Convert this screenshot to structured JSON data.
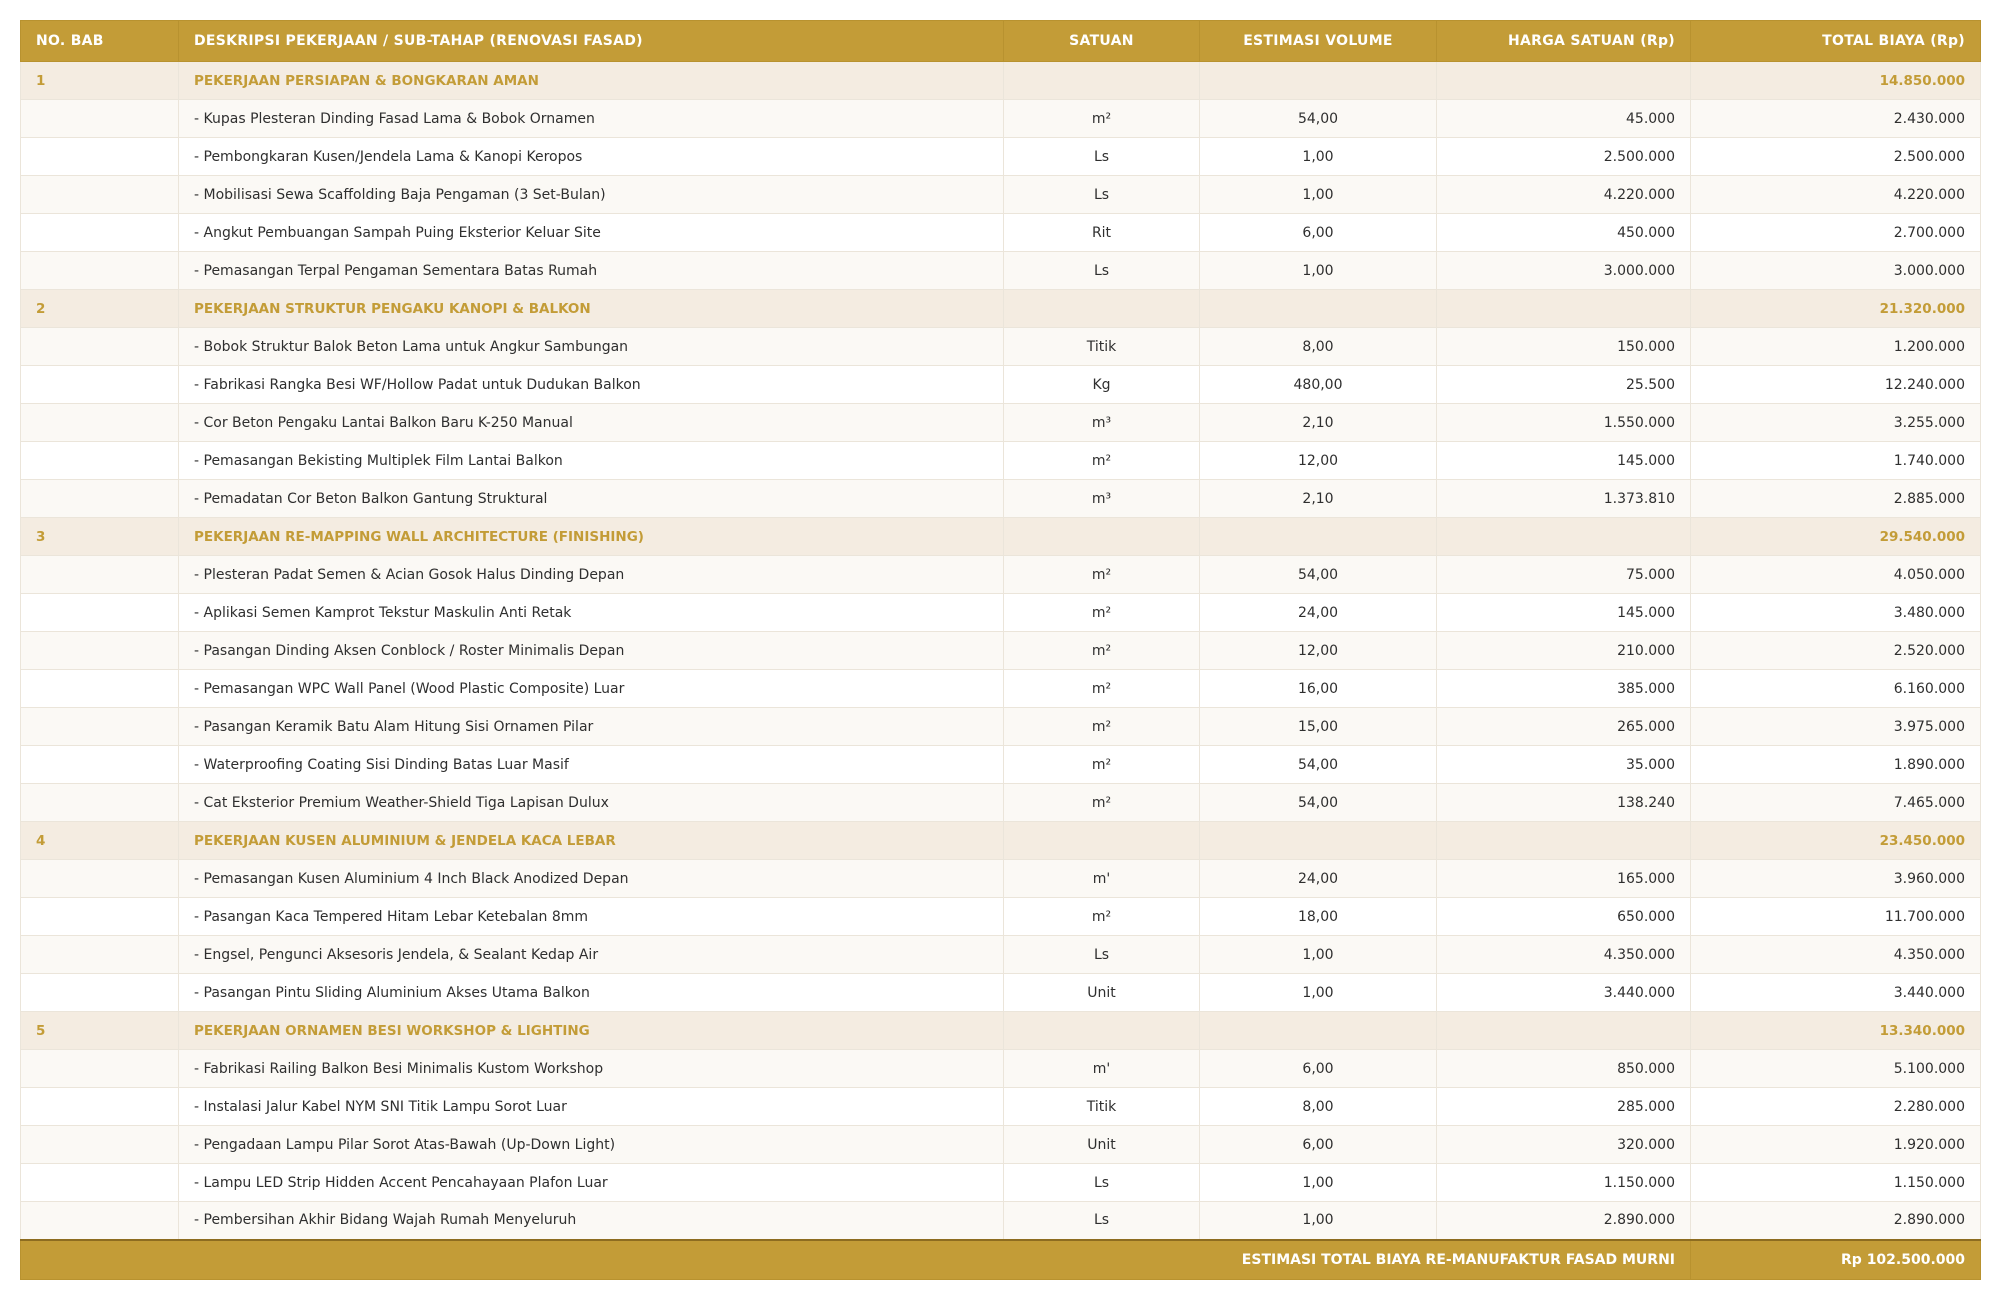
{
  "colors": {
    "header_bg": "#c39c37",
    "header_text": "#ffffff",
    "section_bg": "#f4ece1",
    "section_text": "#c39c37",
    "row_alt_bg": "#fbf9f5",
    "row_bg": "#ffffff",
    "border": "#ebe5da"
  },
  "table": {
    "columns": [
      "NO. BAB",
      "DESKRIPSI PEKERJAAN / SUB-TAHAP (RENOVASI FASAD)",
      "SATUAN",
      "ESTIMASI VOLUME",
      "HARGA SATUAN (Rp)",
      "TOTAL BIAYA (Rp)"
    ],
    "sections": [
      {
        "no": "1",
        "title": "PEKERJAAN PERSIAPAN & BONGKARAN AMAN",
        "total": "14.850.000",
        "items": [
          {
            "desc": "- Kupas Plesteran Dinding Fasad Lama & Bobok Ornamen",
            "unit": "m²",
            "volume": "54,00",
            "price": "45.000",
            "total": "2.430.000"
          },
          {
            "desc": "- Pembongkaran Kusen/Jendela Lama & Kanopi Keropos",
            "unit": "Ls",
            "volume": "1,00",
            "price": "2.500.000",
            "total": "2.500.000"
          },
          {
            "desc": "- Mobilisasi Sewa Scaffolding Baja Pengaman (3 Set-Bulan)",
            "unit": "Ls",
            "volume": "1,00",
            "price": "4.220.000",
            "total": "4.220.000"
          },
          {
            "desc": "- Angkut Pembuangan Sampah Puing Eksterior Keluar Site",
            "unit": "Rit",
            "volume": "6,00",
            "price": "450.000",
            "total": "2.700.000"
          },
          {
            "desc": "- Pemasangan Terpal Pengaman Sementara Batas Rumah",
            "unit": "Ls",
            "volume": "1,00",
            "price": "3.000.000",
            "total": "3.000.000"
          }
        ]
      },
      {
        "no": "2",
        "title": "PEKERJAAN STRUKTUR PENGAKU KANOPI & BALKON",
        "total": "21.320.000",
        "items": [
          {
            "desc": "- Bobok Struktur Balok Beton Lama untuk Angkur Sambungan",
            "unit": "Titik",
            "volume": "8,00",
            "price": "150.000",
            "total": "1.200.000"
          },
          {
            "desc": "- Fabrikasi Rangka Besi WF/Hollow Padat untuk Dudukan Balkon",
            "unit": "Kg",
            "volume": "480,00",
            "price": "25.500",
            "total": "12.240.000"
          },
          {
            "desc": "- Cor Beton Pengaku Lantai Balkon Baru K-250 Manual",
            "unit": "m³",
            "volume": "2,10",
            "price": "1.550.000",
            "total": "3.255.000"
          },
          {
            "desc": "- Pemasangan Bekisting Multiplek Film Lantai Balkon",
            "unit": "m²",
            "volume": "12,00",
            "price": "145.000",
            "total": "1.740.000"
          },
          {
            "desc": "- Pemadatan Cor Beton Balkon Gantung Struktural",
            "unit": "m³",
            "volume": "2,10",
            "price": "1.373.810",
            "total": "2.885.000"
          }
        ]
      },
      {
        "no": "3",
        "title": "PEKERJAAN RE-MAPPING WALL ARCHITECTURE (FINISHING)",
        "total": "29.540.000",
        "items": [
          {
            "desc": "- Plesteran Padat Semen & Acian Gosok Halus Dinding Depan",
            "unit": "m²",
            "volume": "54,00",
            "price": "75.000",
            "total": "4.050.000"
          },
          {
            "desc": "- Aplikasi Semen Kamprot Tekstur Maskulin Anti Retak",
            "unit": "m²",
            "volume": "24,00",
            "price": "145.000",
            "total": "3.480.000"
          },
          {
            "desc": "- Pasangan Dinding Aksen Conblock / Roster Minimalis Depan",
            "unit": "m²",
            "volume": "12,00",
            "price": "210.000",
            "total": "2.520.000"
          },
          {
            "desc": "- Pemasangan WPC Wall Panel (Wood Plastic Composite) Luar",
            "unit": "m²",
            "volume": "16,00",
            "price": "385.000",
            "total": "6.160.000"
          },
          {
            "desc": "- Pasangan Keramik Batu Alam Hitung Sisi Ornamen Pilar",
            "unit": "m²",
            "volume": "15,00",
            "price": "265.000",
            "total": "3.975.000"
          },
          {
            "desc": "- Waterproofing Coating Sisi Dinding Batas Luar Masif",
            "unit": "m²",
            "volume": "54,00",
            "price": "35.000",
            "total": "1.890.000"
          },
          {
            "desc": "- Cat Eksterior Premium Weather-Shield Tiga Lapisan Dulux",
            "unit": "m²",
            "volume": "54,00",
            "price": "138.240",
            "total": "7.465.000"
          }
        ]
      },
      {
        "no": "4",
        "title": "PEKERJAAN KUSEN ALUMINIUM & JENDELA KACA LEBAR",
        "total": "23.450.000",
        "items": [
          {
            "desc": "- Pemasangan Kusen Aluminium 4 Inch Black Anodized Depan",
            "unit": "m'",
            "volume": "24,00",
            "price": "165.000",
            "total": "3.960.000"
          },
          {
            "desc": "- Pasangan Kaca Tempered Hitam Lebar Ketebalan 8mm",
            "unit": "m²",
            "volume": "18,00",
            "price": "650.000",
            "total": "11.700.000"
          },
          {
            "desc": "- Engsel, Pengunci Aksesoris Jendela, & Sealant Kedap Air",
            "unit": "Ls",
            "volume": "1,00",
            "price": "4.350.000",
            "total": "4.350.000"
          },
          {
            "desc": "- Pasangan Pintu Sliding Aluminium Akses Utama Balkon",
            "unit": "Unit",
            "volume": "1,00",
            "price": "3.440.000",
            "total": "3.440.000"
          }
        ]
      },
      {
        "no": "5",
        "title": "PEKERJAAN ORNAMEN BESI WORKSHOP & LIGHTING",
        "total": "13.340.000",
        "items": [
          {
            "desc": "- Fabrikasi Railing Balkon Besi Minimalis Kustom Workshop",
            "unit": "m'",
            "volume": "6,00",
            "price": "850.000",
            "total": "5.100.000"
          },
          {
            "desc": "- Instalasi Jalur Kabel NYM SNI Titik Lampu Sorot Luar",
            "unit": "Titik",
            "volume": "8,00",
            "price": "285.000",
            "total": "2.280.000"
          },
          {
            "desc": "- Pengadaan Lampu Pilar Sorot Atas-Bawah (Up-Down Light)",
            "unit": "Unit",
            "volume": "6,00",
            "price": "320.000",
            "total": "1.920.000"
          },
          {
            "desc": "- Lampu LED Strip Hidden Accent Pencahayaan Plafon Luar",
            "unit": "Ls",
            "volume": "1,00",
            "price": "1.150.000",
            "total": "1.150.000"
          },
          {
            "desc": "- Pembersihan Akhir Bidang Wajah Rumah Menyeluruh",
            "unit": "Ls",
            "volume": "1,00",
            "price": "2.890.000",
            "total": "2.890.000"
          }
        ]
      }
    ],
    "footer": {
      "label": "ESTIMASI TOTAL BIAYA RE-MANUFAKTUR FASAD MURNI",
      "total": "Rp 102.500.000"
    }
  }
}
